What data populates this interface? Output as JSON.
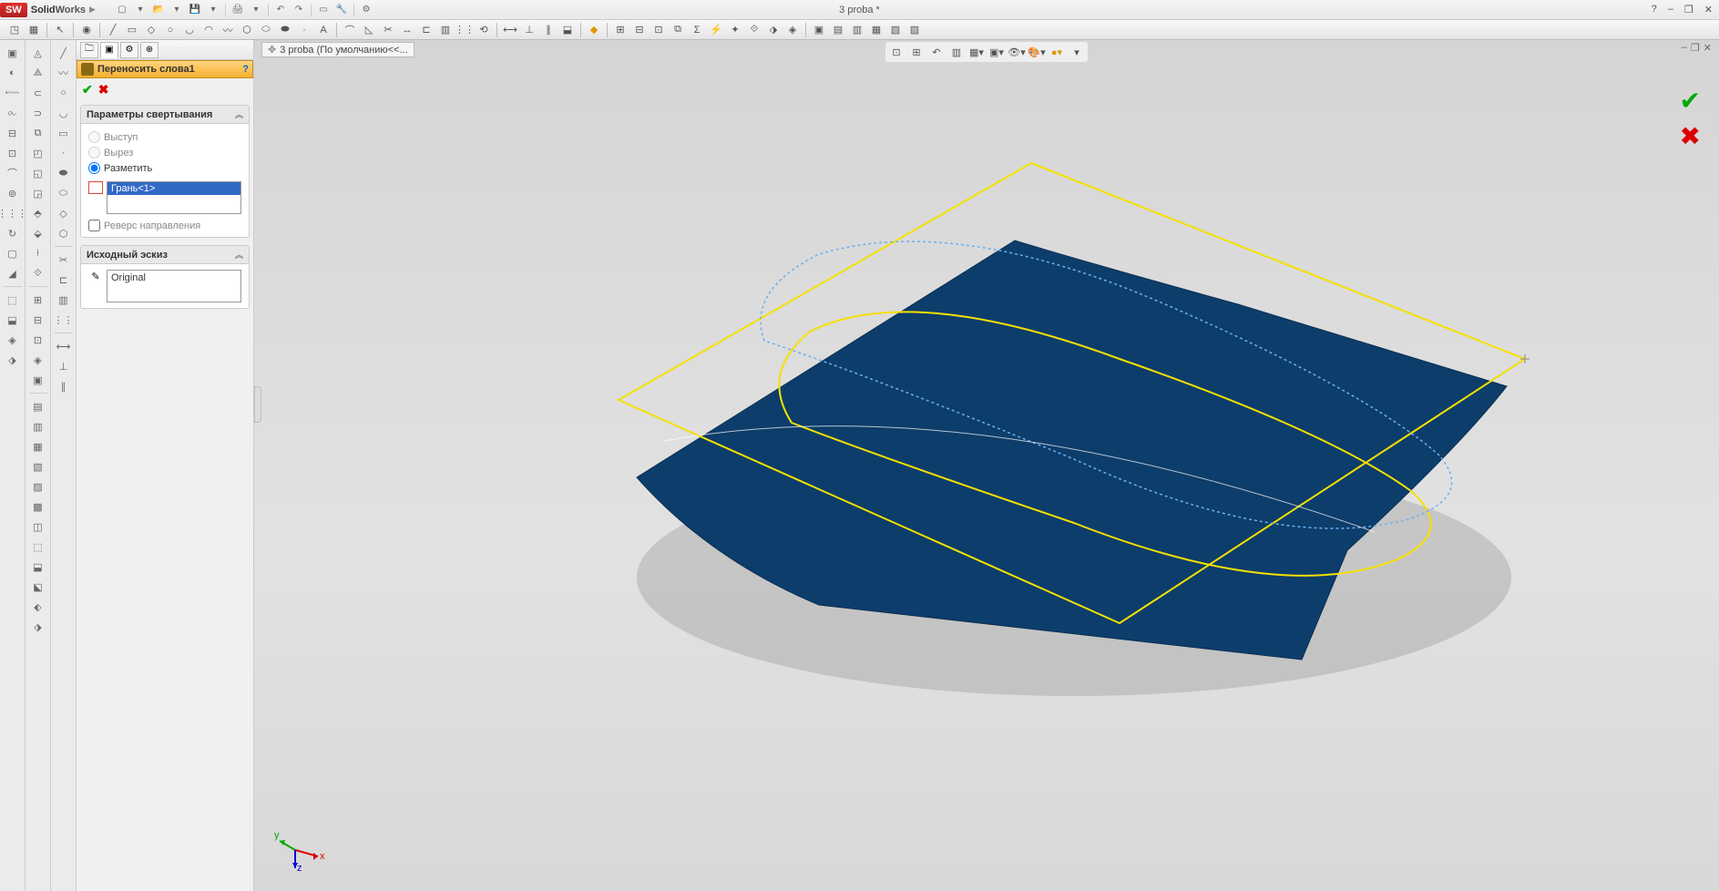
{
  "app": {
    "name_prefix": "Solid",
    "name_suffix": "Works"
  },
  "document": {
    "title": "3 proba *",
    "tab_text": "3 proba  (По умолчанию<<..."
  },
  "feature": {
    "title": "Переносить слова1",
    "section1": {
      "title": "Параметры свертывания",
      "radio1": "Выступ",
      "radio2": "Вырез",
      "radio3": "Разметить",
      "selected_face": "Грань<1>",
      "reverse": "Реверс направления"
    },
    "section2": {
      "title": "Исходный эскиз",
      "value": "Original"
    }
  },
  "title_controls": {
    "help": "?",
    "min": "–",
    "restore": "❐",
    "close": "✕"
  },
  "doc_controls": {
    "min": "–",
    "restore": "❐",
    "close": "✕"
  }
}
